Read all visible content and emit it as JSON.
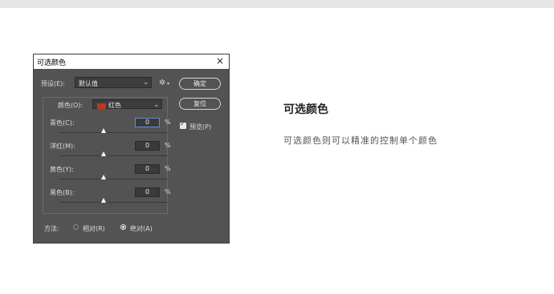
{
  "dialog": {
    "title": "可选颜色",
    "close_glyph": "×",
    "preset_label": "预设(E):",
    "preset_value": "默认值",
    "ok_label": "确定",
    "reset_label": "复位",
    "preview_label": "预览(P)",
    "preview_checked": true,
    "colors_label": "颜色(O):",
    "colors_value": "红色",
    "colors_swatch": "#c2331f",
    "sliders": [
      {
        "label": "青色(C):",
        "value": "0",
        "unit": "%"
      },
      {
        "label": "洋红(M):",
        "value": "0",
        "unit": "%"
      },
      {
        "label": "黄色(Y):",
        "value": "0",
        "unit": "%"
      },
      {
        "label": "黑色(B):",
        "value": "0",
        "unit": "%"
      }
    ],
    "method_label": "方法:",
    "method_relative": "相对(R)",
    "method_absolute": "绝对(A)",
    "method_selected": "absolute"
  },
  "text": {
    "heading": "可选颜色",
    "description": "可选颜色则可以精准的控制单个颜色"
  }
}
